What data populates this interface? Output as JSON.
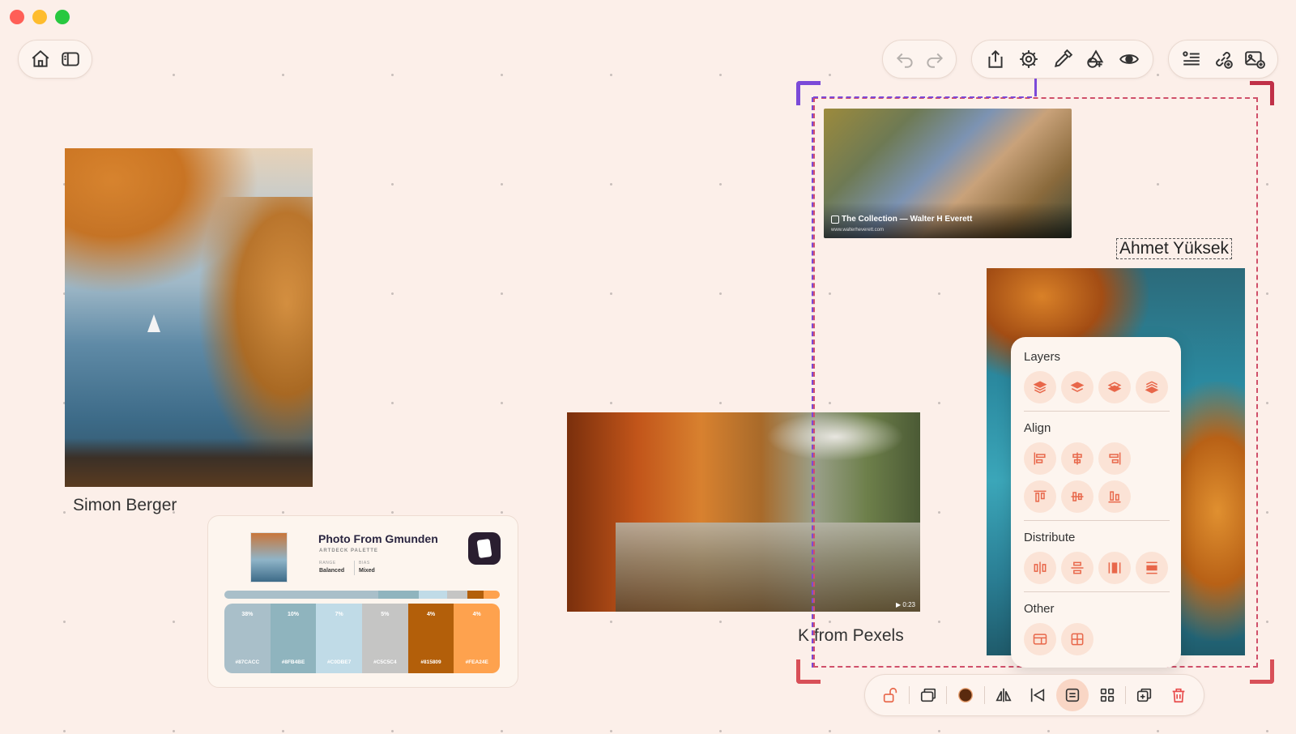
{
  "window": {
    "controls": [
      "close",
      "minimize",
      "zoom"
    ]
  },
  "toolbar_left": {
    "icons": [
      "home-icon",
      "sidebar-icon"
    ]
  },
  "toolbar_history": {
    "icons": [
      "undo-icon",
      "redo-icon"
    ]
  },
  "toolbar_main": {
    "icons": [
      "share-icon",
      "settings-icon",
      "eyedropper-icon",
      "shapes-icon",
      "preview-icon"
    ]
  },
  "toolbar_right": {
    "icons": [
      "add-text-icon",
      "add-link-icon",
      "add-image-icon"
    ]
  },
  "canvas": {
    "captions": {
      "lake": "Simon Berger",
      "river": "K from Pexels",
      "selected": "Ahmet Yüksek"
    },
    "painting": {
      "title": "The Collection — Walter H Everett",
      "url": "www.walterheverett.com"
    },
    "video_duration": "▶ 0:23"
  },
  "palette_card": {
    "title": "Photo From Gmunden",
    "subtitle": "ARTDECK PALETTE",
    "range_label": "RANGE",
    "range_value": "Balanced",
    "bias_label": "BIAS",
    "bias_value": "Mixed",
    "swatches": [
      {
        "percent": "38%",
        "hex": "#87CACC",
        "color": "#a9bfc9"
      },
      {
        "percent": "10%",
        "hex": "#8FB4BE",
        "color": "#8fb4be"
      },
      {
        "percent": "7%",
        "hex": "#C0DBE7",
        "color": "#c0dbe7"
      },
      {
        "percent": "5%",
        "hex": "#C5C5C4",
        "color": "#c5c5c4"
      },
      {
        "percent": "4%",
        "hex": "#815809",
        "color": "#b35f0a"
      },
      {
        "percent": "4%",
        "hex": "#FEA24E",
        "color": "#fea24e"
      }
    ],
    "bar_weights": [
      38,
      10,
      7,
      5,
      4,
      4
    ]
  },
  "arrange_panel": {
    "sections": [
      {
        "title": "Layers",
        "buttons": [
          "bring-to-front-icon",
          "bring-forward-icon",
          "send-backward-icon",
          "send-to-back-icon"
        ]
      },
      {
        "title": "Align",
        "buttons": [
          "align-left-icon",
          "align-center-horizontal-icon",
          "align-right-icon",
          "align-top-icon",
          "align-middle-vertical-icon",
          "align-bottom-icon"
        ]
      },
      {
        "title": "Distribute",
        "buttons": [
          "distribute-horizontal-icon",
          "distribute-vertical-icon",
          "distribute-width-icon",
          "distribute-height-icon"
        ]
      },
      {
        "title": "Other",
        "buttons": [
          "layout-icon",
          "grid-icon"
        ]
      }
    ]
  },
  "bottom_toolbar": {
    "icons": [
      "unlock-icon",
      "frame-icon",
      "color-icon",
      "flip-horizontal-icon",
      "flip-vertical-icon",
      "arrange-icon",
      "grid-view-icon",
      "duplicate-icon",
      "delete-icon"
    ],
    "active": "arrange-icon"
  },
  "colors": {
    "background": "#fcefe9",
    "accent": "#e8674a",
    "selection_purple": "#7b4ad8",
    "selection_red": "#d0506a"
  }
}
